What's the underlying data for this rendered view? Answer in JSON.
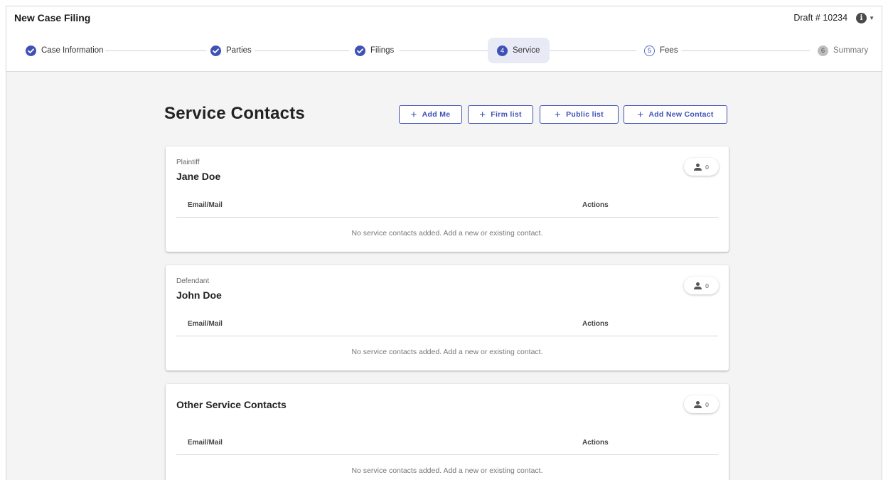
{
  "app": {
    "title": "New Case Filing",
    "draft": "Draft # 10234"
  },
  "stepper": [
    {
      "label": "Case Information",
      "status": "done",
      "badge": ""
    },
    {
      "label": "Parties",
      "status": "done",
      "badge": ""
    },
    {
      "label": "Filings",
      "status": "done",
      "badge": ""
    },
    {
      "label": "Service",
      "status": "active",
      "badge": "4"
    },
    {
      "label": "Fees",
      "status": "pending",
      "badge": "5"
    },
    {
      "label": "Summary",
      "status": "disabled",
      "badge": "6"
    }
  ],
  "page": {
    "title": "Service Contacts",
    "buttons": {
      "add_me": "Add Me",
      "firm_list": "Firm list",
      "public_list": "Public list",
      "add_new": "Add New Contact"
    }
  },
  "cards": [
    {
      "role": "Plaintiff",
      "name": "Jane Doe",
      "count": "0",
      "col_email": "Email/Mail",
      "col_actions": "Actions",
      "empty": "No service contacts added. Add a new or existing contact."
    },
    {
      "role": "Defendant",
      "name": "John Doe",
      "count": "0",
      "col_email": "Email/Mail",
      "col_actions": "Actions",
      "empty": "No service contacts added. Add a new or existing contact."
    },
    {
      "role": "",
      "name": "Other Service Contacts",
      "count": "0",
      "col_email": "Email/Mail",
      "col_actions": "Actions",
      "empty": "No service contacts added. Add a new or existing contact."
    }
  ],
  "icons": {
    "step_done": "check-circle-icon",
    "info": "info-icon",
    "contacts": "person-icon",
    "add": "plus-icon"
  },
  "colors": {
    "primary": "#3f51b5",
    "active_step_bg": "#e8eaf6",
    "page_bg": "#f4f4f4"
  }
}
